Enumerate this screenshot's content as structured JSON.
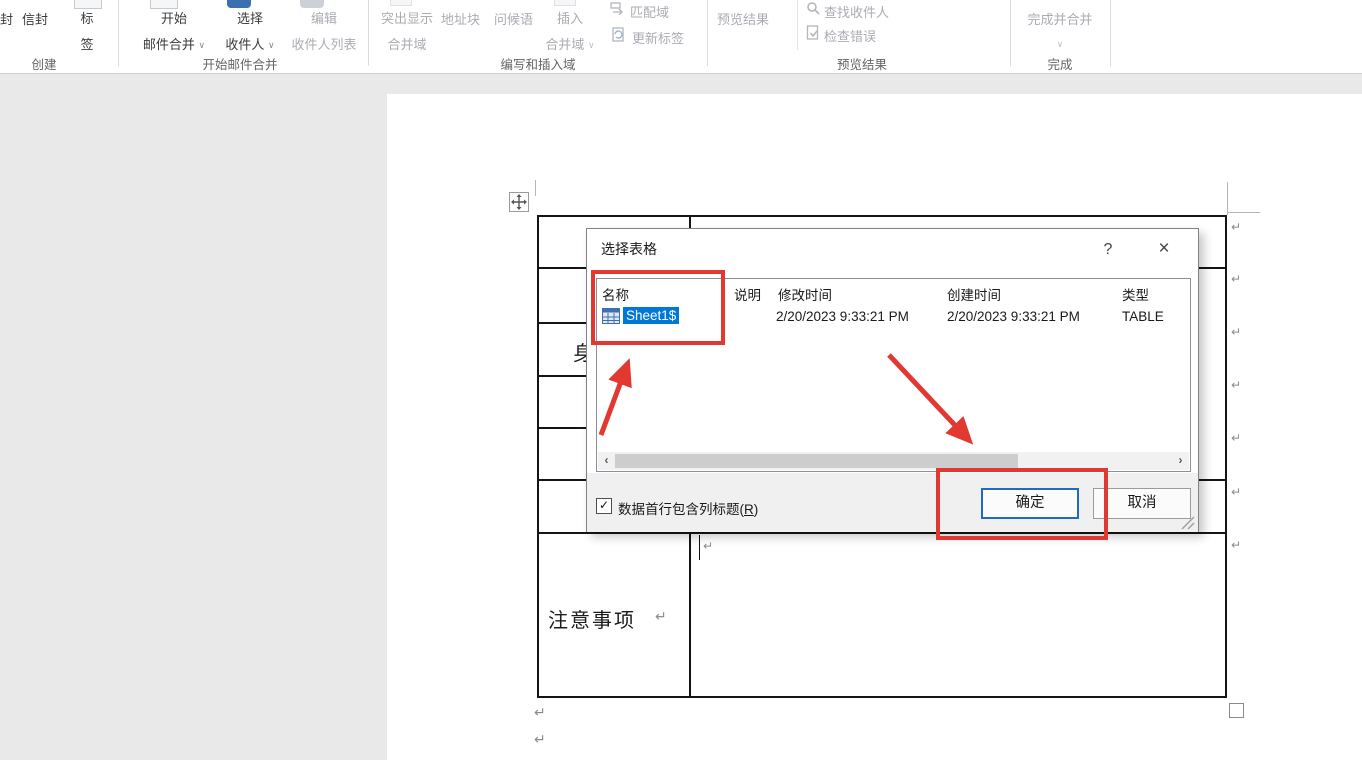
{
  "ribbon": {
    "partial_button": "封",
    "envelope": "信封",
    "labels_line1": "标",
    "labels_line2": "签",
    "start_line1": "开始",
    "start_line2": "邮件合并",
    "select_line1": "选择",
    "select_line2": "收件人",
    "edit_line1": "编辑",
    "edit_line2": "收件人列表",
    "highlight_line1": "突出显示",
    "highlight_line2": "合并域",
    "address_block": "地址块",
    "greeting_line": "问候语",
    "insert_line1": "插入",
    "insert_line2": "合并域",
    "match_fields": "匹配域",
    "update_labels": "更新标签",
    "preview_results_button": "预览结果",
    "find_recipient": "查找收件人",
    "check_errors": "检查错误",
    "finish_merge": "完成并合并",
    "chevron": "∨",
    "groups": {
      "create": "创建",
      "start_mail_merge": "开始邮件合并",
      "write_insert_fields": "编写和插入域",
      "preview_results": "预览结果",
      "finish": "完成"
    }
  },
  "document": {
    "clipped_cell_text": "身",
    "notes_cell_text": "注意事项",
    "pilcrow": "↵"
  },
  "dialog": {
    "title": "选择表格",
    "help_button": "?",
    "close_button": "×",
    "columns": {
      "name": "名称",
      "description": "说明",
      "modified": "修改时间",
      "created": "创建时间",
      "type": "类型"
    },
    "row": {
      "name": "Sheet1$",
      "description": "",
      "modified": "2/20/2023 9:33:21 PM",
      "created": "2/20/2023 9:33:21 PM",
      "type": "TABLE"
    },
    "scroll_left": "‹",
    "scroll_right": "›",
    "checkbox_checked": "✓",
    "checkbox_label_pre": "数据首行包含列标题(",
    "checkbox_label_key": "R",
    "checkbox_label_post": ")",
    "ok_button": "确定",
    "cancel_button": "取消"
  },
  "colors": {
    "selection_blue": "#0078d7",
    "annotation_red": "#e23832",
    "disabled_text": "#aaacb2",
    "page_background": "#e9e9e9"
  }
}
